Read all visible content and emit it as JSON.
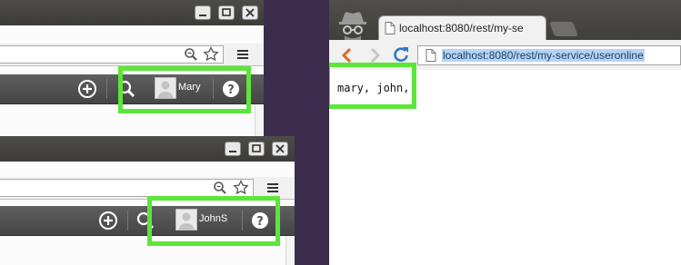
{
  "window_top": {
    "user": {
      "name": "Mary"
    }
  },
  "window_bottom": {
    "user": {
      "name": "JohnS"
    }
  },
  "window_right": {
    "tab": {
      "title": "localhost:8080/rest/my-se"
    },
    "address": {
      "url": "localhost:8080/rest/my-service/useronline"
    },
    "page": {
      "text": "mary, john,"
    }
  },
  "colors": {
    "highlight": "#5ce63a",
    "titlebar": "#3c3b38",
    "appbar": "#4f4f4f",
    "accent_blue": "#2f78c8"
  }
}
